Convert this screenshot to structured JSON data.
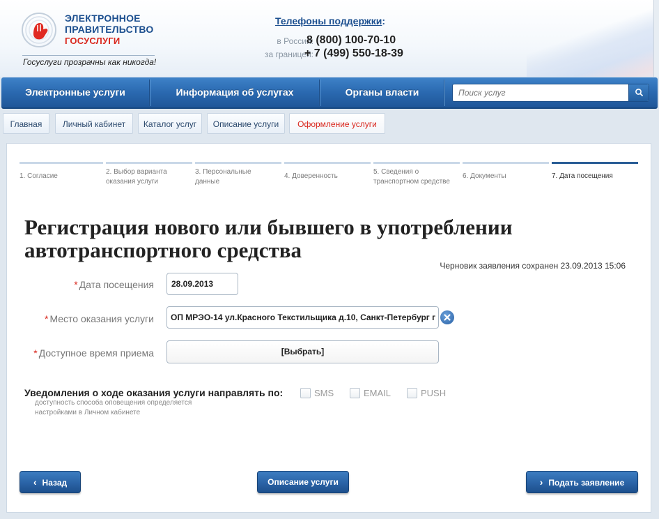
{
  "header": {
    "logo_line1": "ЭЛЕКТРОННОЕ",
    "logo_line2": "ПРАВИТЕЛЬСТВО",
    "logo_line3": "ГОСУСЛУГИ",
    "slogan": "Госуслуги прозрачны как никогда!",
    "support_title": "Телефоны поддержки",
    "support_colon": ":",
    "phones": [
      {
        "label": "в России:",
        "number": "8 (800) 100-70-10"
      },
      {
        "label": "за границей:",
        "number": "+ 7 (499) 550-18-39"
      }
    ]
  },
  "nav": {
    "items": [
      "Электронные услуги",
      "Информация об услугах",
      "Органы власти"
    ],
    "search_placeholder": "Поиск услуг"
  },
  "breadcrumbs": [
    "Главная",
    "Личный кабинет",
    "Каталог услуг",
    "Описание услуги",
    "Оформление услуги"
  ],
  "steps": [
    {
      "label": "1. Согласие"
    },
    {
      "label": "2. Выбор варианта оказания услуги"
    },
    {
      "label": "3. Персональные данные"
    },
    {
      "label": "4. Доверенность"
    },
    {
      "label": "5. Сведения о транспортном средстве"
    },
    {
      "label": "6. Документы"
    },
    {
      "label": "7. Дата посещения"
    }
  ],
  "title": "Регистрация нового или бывшего в употреблении автотранспортного средства",
  "draft_note": "Черновик заявления сохранен 23.09.2013 15:06",
  "form": {
    "required_mark": "*",
    "date_label": "Дата посещения",
    "date_value": "28.09.2013",
    "place_label": "Место оказания услуги",
    "place_value": "ОП МРЭО-14 ул.Красного Текстильщика д.10, Санкт-Петербург г :",
    "time_label": "Доступное время приема",
    "time_value": "[Выбрать]"
  },
  "notify": {
    "title": "Уведомления о ходе оказания услуги направлять по:",
    "hint_line1": "доступность способа оповещения определяется",
    "hint_line2": "настройками в Личном кабинете",
    "options": [
      "SMS",
      "EMAIL",
      "PUSH"
    ]
  },
  "buttons": {
    "back": "Назад",
    "description": "Описание услуги",
    "submit": "Подать заявление"
  },
  "colors": {
    "brand_blue": "#2a69b0",
    "accent_red": "#d9261c"
  }
}
